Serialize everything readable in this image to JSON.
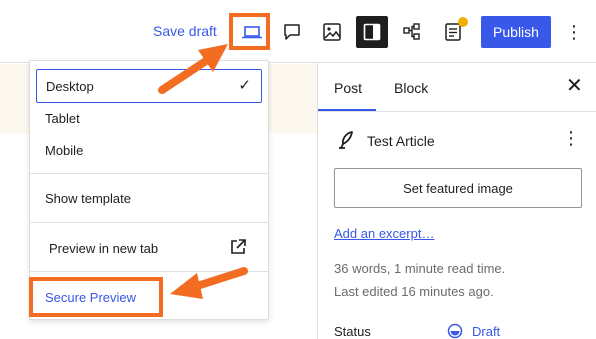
{
  "toolbar": {
    "save_draft": "Save draft",
    "publish": "Publish",
    "more": "⋮",
    "icons": [
      "laptop-preview-icon",
      "comment-icon",
      "image-icon",
      "sidebar-toggle-icon",
      "document-structure-icon",
      "document-info-icon"
    ],
    "notification_color": "#f0b000"
  },
  "preview_menu": {
    "items": [
      {
        "label": "Desktop",
        "selected": true
      },
      {
        "label": "Tablet",
        "selected": false
      },
      {
        "label": "Mobile",
        "selected": false
      }
    ],
    "check": "✓",
    "show_template": "Show template",
    "preview_new_tab": "Preview in new tab",
    "secure_preview": "Secure Preview"
  },
  "sidebar": {
    "tabs": [
      {
        "label": "Post",
        "active": true
      },
      {
        "label": "Block",
        "active": false
      }
    ],
    "close": "✕",
    "article_title": "Test Article",
    "article_more": "⋮",
    "featured_image": "Set featured image",
    "excerpt": "Add an excerpt…",
    "word_count": "36 words, 1 minute read time.",
    "last_edited": "Last edited 16 minutes ago.",
    "status_label": "Status",
    "status_value": "Draft"
  },
  "colors": {
    "accent": "#3858e9",
    "highlight": "#f26c21",
    "canvas_band": "#fdf8ef"
  }
}
